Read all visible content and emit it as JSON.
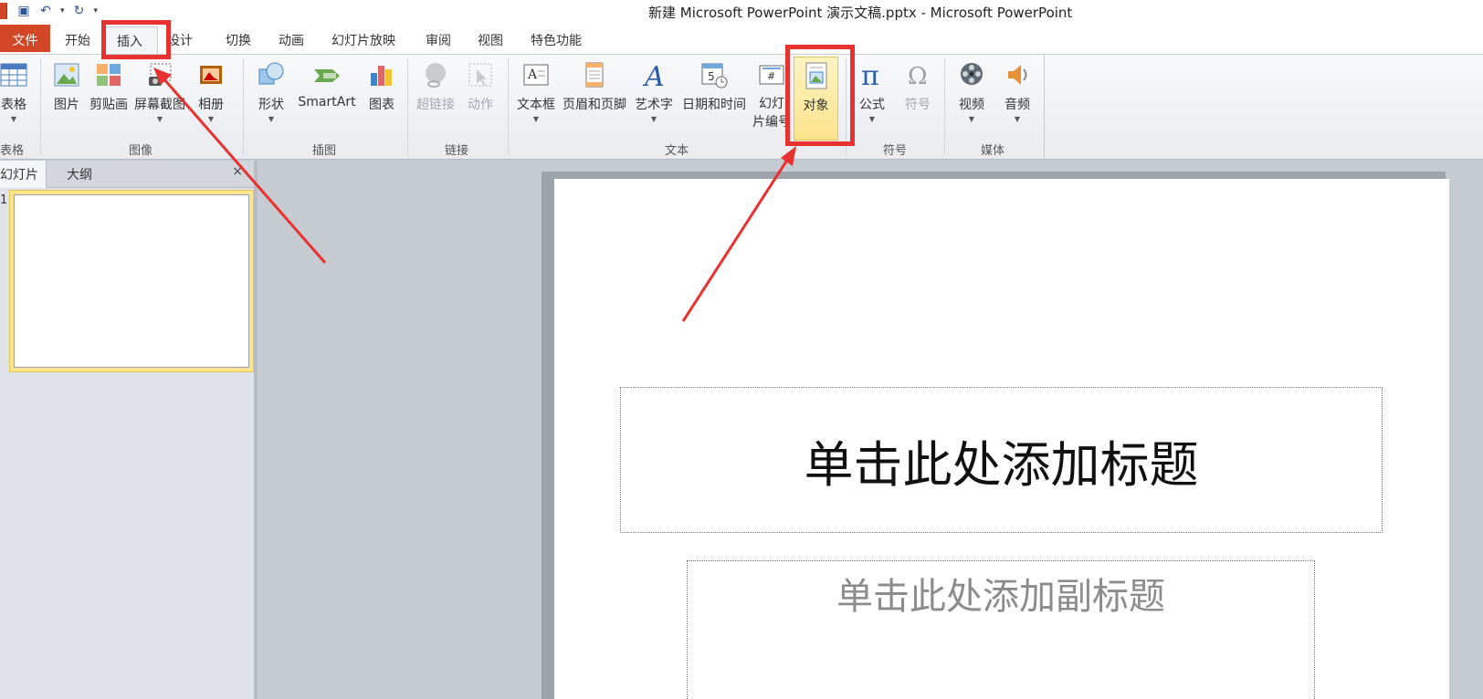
{
  "window": {
    "title": "新建 Microsoft PowerPoint 演示文稿.pptx - Microsoft PowerPoint"
  },
  "quick_access": {
    "save_icon": "save-icon",
    "undo_icon": "undo-icon",
    "redo_icon": "redo-icon",
    "customize_icon": "customize-qat-icon"
  },
  "tabs": {
    "file": "文件",
    "home": "开始",
    "insert": "插入",
    "design": "设计",
    "transitions": "切换",
    "animations": "动画",
    "slideshow": "幻灯片放映",
    "review": "审阅",
    "view": "视图",
    "special": "特色功能",
    "active": "插入"
  },
  "ribbon": {
    "groups": {
      "tables": "表格",
      "images": "图像",
      "illustrations": "插图",
      "links": "链接",
      "text": "文本",
      "symbols": "符号",
      "media": "媒体"
    },
    "buttons": {
      "table": "表格",
      "picture": "图片",
      "clipart": "剪贴画",
      "screenshot": "屏幕截图",
      "album": "相册",
      "shapes": "形状",
      "smartart": "SmartArt",
      "chart": "图表",
      "hyperlink": "超链接",
      "action": "动作",
      "textbox": "文本框",
      "header_footer": "页眉和页脚",
      "wordart": "艺术字",
      "datetime": "日期和时间",
      "slide_number_line1": "幻灯",
      "slide_number_line2": "片编号",
      "object": "对象",
      "equation": "公式",
      "symbol": "符号",
      "video": "视频",
      "audio": "音频"
    },
    "selected_button": "对象",
    "disabled_buttons": [
      "超链接",
      "动作"
    ]
  },
  "panel": {
    "tab_slides": "幻灯片",
    "tab_outline": "大纲",
    "close": "×",
    "slide_number": "1"
  },
  "slide": {
    "title_placeholder": "单击此处添加标题",
    "subtitle_placeholder": "单击此处添加副标题"
  },
  "annotations": {
    "highlight_color": "#e8322f",
    "highlighted": [
      "插入",
      "对象"
    ]
  }
}
